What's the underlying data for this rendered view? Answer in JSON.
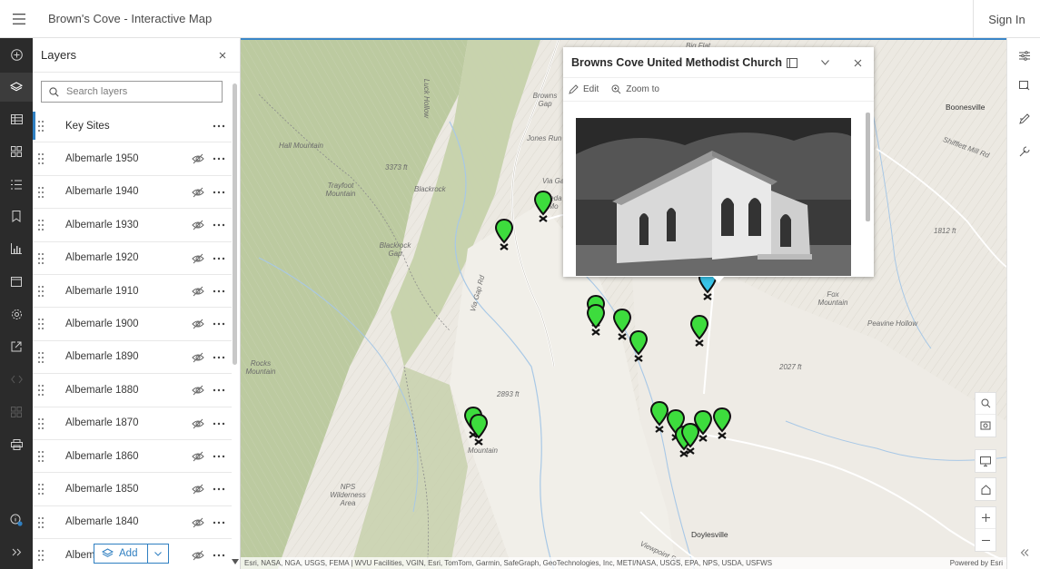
{
  "header": {
    "title": "Brown's Cove - Interactive Map",
    "signin_label": "Sign In"
  },
  "actionbar": {
    "items": [
      {
        "name": "add-data-icon"
      },
      {
        "name": "layers-icon"
      },
      {
        "name": "table-icon"
      },
      {
        "name": "basemap-icon"
      },
      {
        "name": "legend-icon"
      },
      {
        "name": "bookmark-icon"
      },
      {
        "name": "charts-icon"
      },
      {
        "name": "properties-icon"
      },
      {
        "name": "settings-icon"
      },
      {
        "name": "share-icon"
      },
      {
        "name": "embed-icon"
      },
      {
        "name": "widgets-icon"
      },
      {
        "name": "print-icon"
      },
      {
        "name": "info-icon"
      },
      {
        "name": "expand-icon"
      }
    ]
  },
  "layers_panel": {
    "title": "Layers",
    "search_placeholder": "Search layers",
    "add_label": "Add",
    "layers": [
      {
        "name": "Key Sites",
        "selected": true
      },
      {
        "name": "Albemarle 1950"
      },
      {
        "name": "Albemarle 1940"
      },
      {
        "name": "Albemarle 1930"
      },
      {
        "name": "Albemarle 1920"
      },
      {
        "name": "Albemarle 1910"
      },
      {
        "name": "Albemarle 1900"
      },
      {
        "name": "Albemarle 1890"
      },
      {
        "name": "Albemarle 1880"
      },
      {
        "name": "Albemarle 1870"
      },
      {
        "name": "Albemarle 1860"
      },
      {
        "name": "Albemarle 1850"
      },
      {
        "name": "Albemarle 1840"
      },
      {
        "name": "Albem"
      }
    ]
  },
  "popup": {
    "title": "Browns Cove United Methodist Church",
    "edit_label": "Edit",
    "zoom_label": "Zoom to"
  },
  "map": {
    "labels": {
      "hall_mountain": "Hall Mountain",
      "trayfoot_mountain": "Trayfoot Mountain",
      "blackrock": "Blackrock",
      "blackrock_gap": "Blackrock Gap",
      "via_gap": "Via Gap",
      "big_flat": "Big Flat",
      "browns_gap": "Browns Gap",
      "jones_run": "Jones Run",
      "rocks_mountain": "Rocks Mountain",
      "fox_mountain": "Fox Mountain",
      "peavine_hollow": "Peavine Hollow",
      "boonesville": "Boonesville",
      "doylesville": "Doylesville",
      "nps_wilderness": "NPS Wilderness Area",
      "elev_1": "2893 ft",
      "elev_2": "2027 ft",
      "elev_3": "1812 ft",
      "elev_4": "3373 ft",
      "luck_hollow": "Luck Hollow",
      "via_gap_rd": "Via Gap Rd",
      "shifflett_mill": "Shifflett Mill Rd",
      "viewpoint_rd": "Viewpoint Rd",
      "cedar_mtn": "Ceda Mo",
      "mountain_sw": "Mountain"
    },
    "attribution": "Esri, NASA, NGA, USGS, FEMA | WVU Facilities, VGIN, Esri, TomTom, Garmin, SafeGraph, GeoTechnologies, Inc, METI/NASA, USGS, EPA, NPS, USDA, USFWS",
    "powered": "Powered by Esri",
    "pin_color": "#3ddc3d",
    "selected_pin_color": "#39c4e8"
  },
  "map_controls": [
    {
      "name": "search-icon"
    },
    {
      "name": "locate-icon"
    },
    {
      "name": "screen-icon"
    },
    {
      "name": "home-icon"
    },
    {
      "name": "zoom-in-icon"
    },
    {
      "name": "zoom-out-icon"
    }
  ],
  "rightbar": {
    "items": [
      {
        "name": "filter-settings-icon"
      },
      {
        "name": "analysis-icon"
      },
      {
        "name": "sketch-icon"
      },
      {
        "name": "tools-icon"
      },
      {
        "name": "collapse-icon"
      }
    ]
  }
}
